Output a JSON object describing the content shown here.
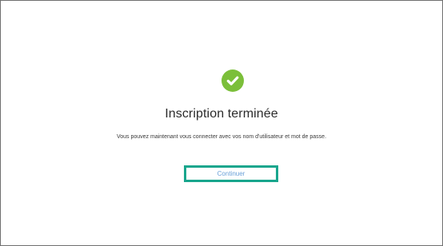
{
  "completion_panel": {
    "icon": "check-circle-icon",
    "title": "Inscription terminée",
    "message": "Vous pouvez maintenant vous connecter avec vos nom d'utilisateur et mot de passe.",
    "continue_label": "Continuer"
  },
  "colors": {
    "success": "#7bbf3a",
    "button_outline": "#19a68d",
    "button_text": "#6aa0d8"
  }
}
